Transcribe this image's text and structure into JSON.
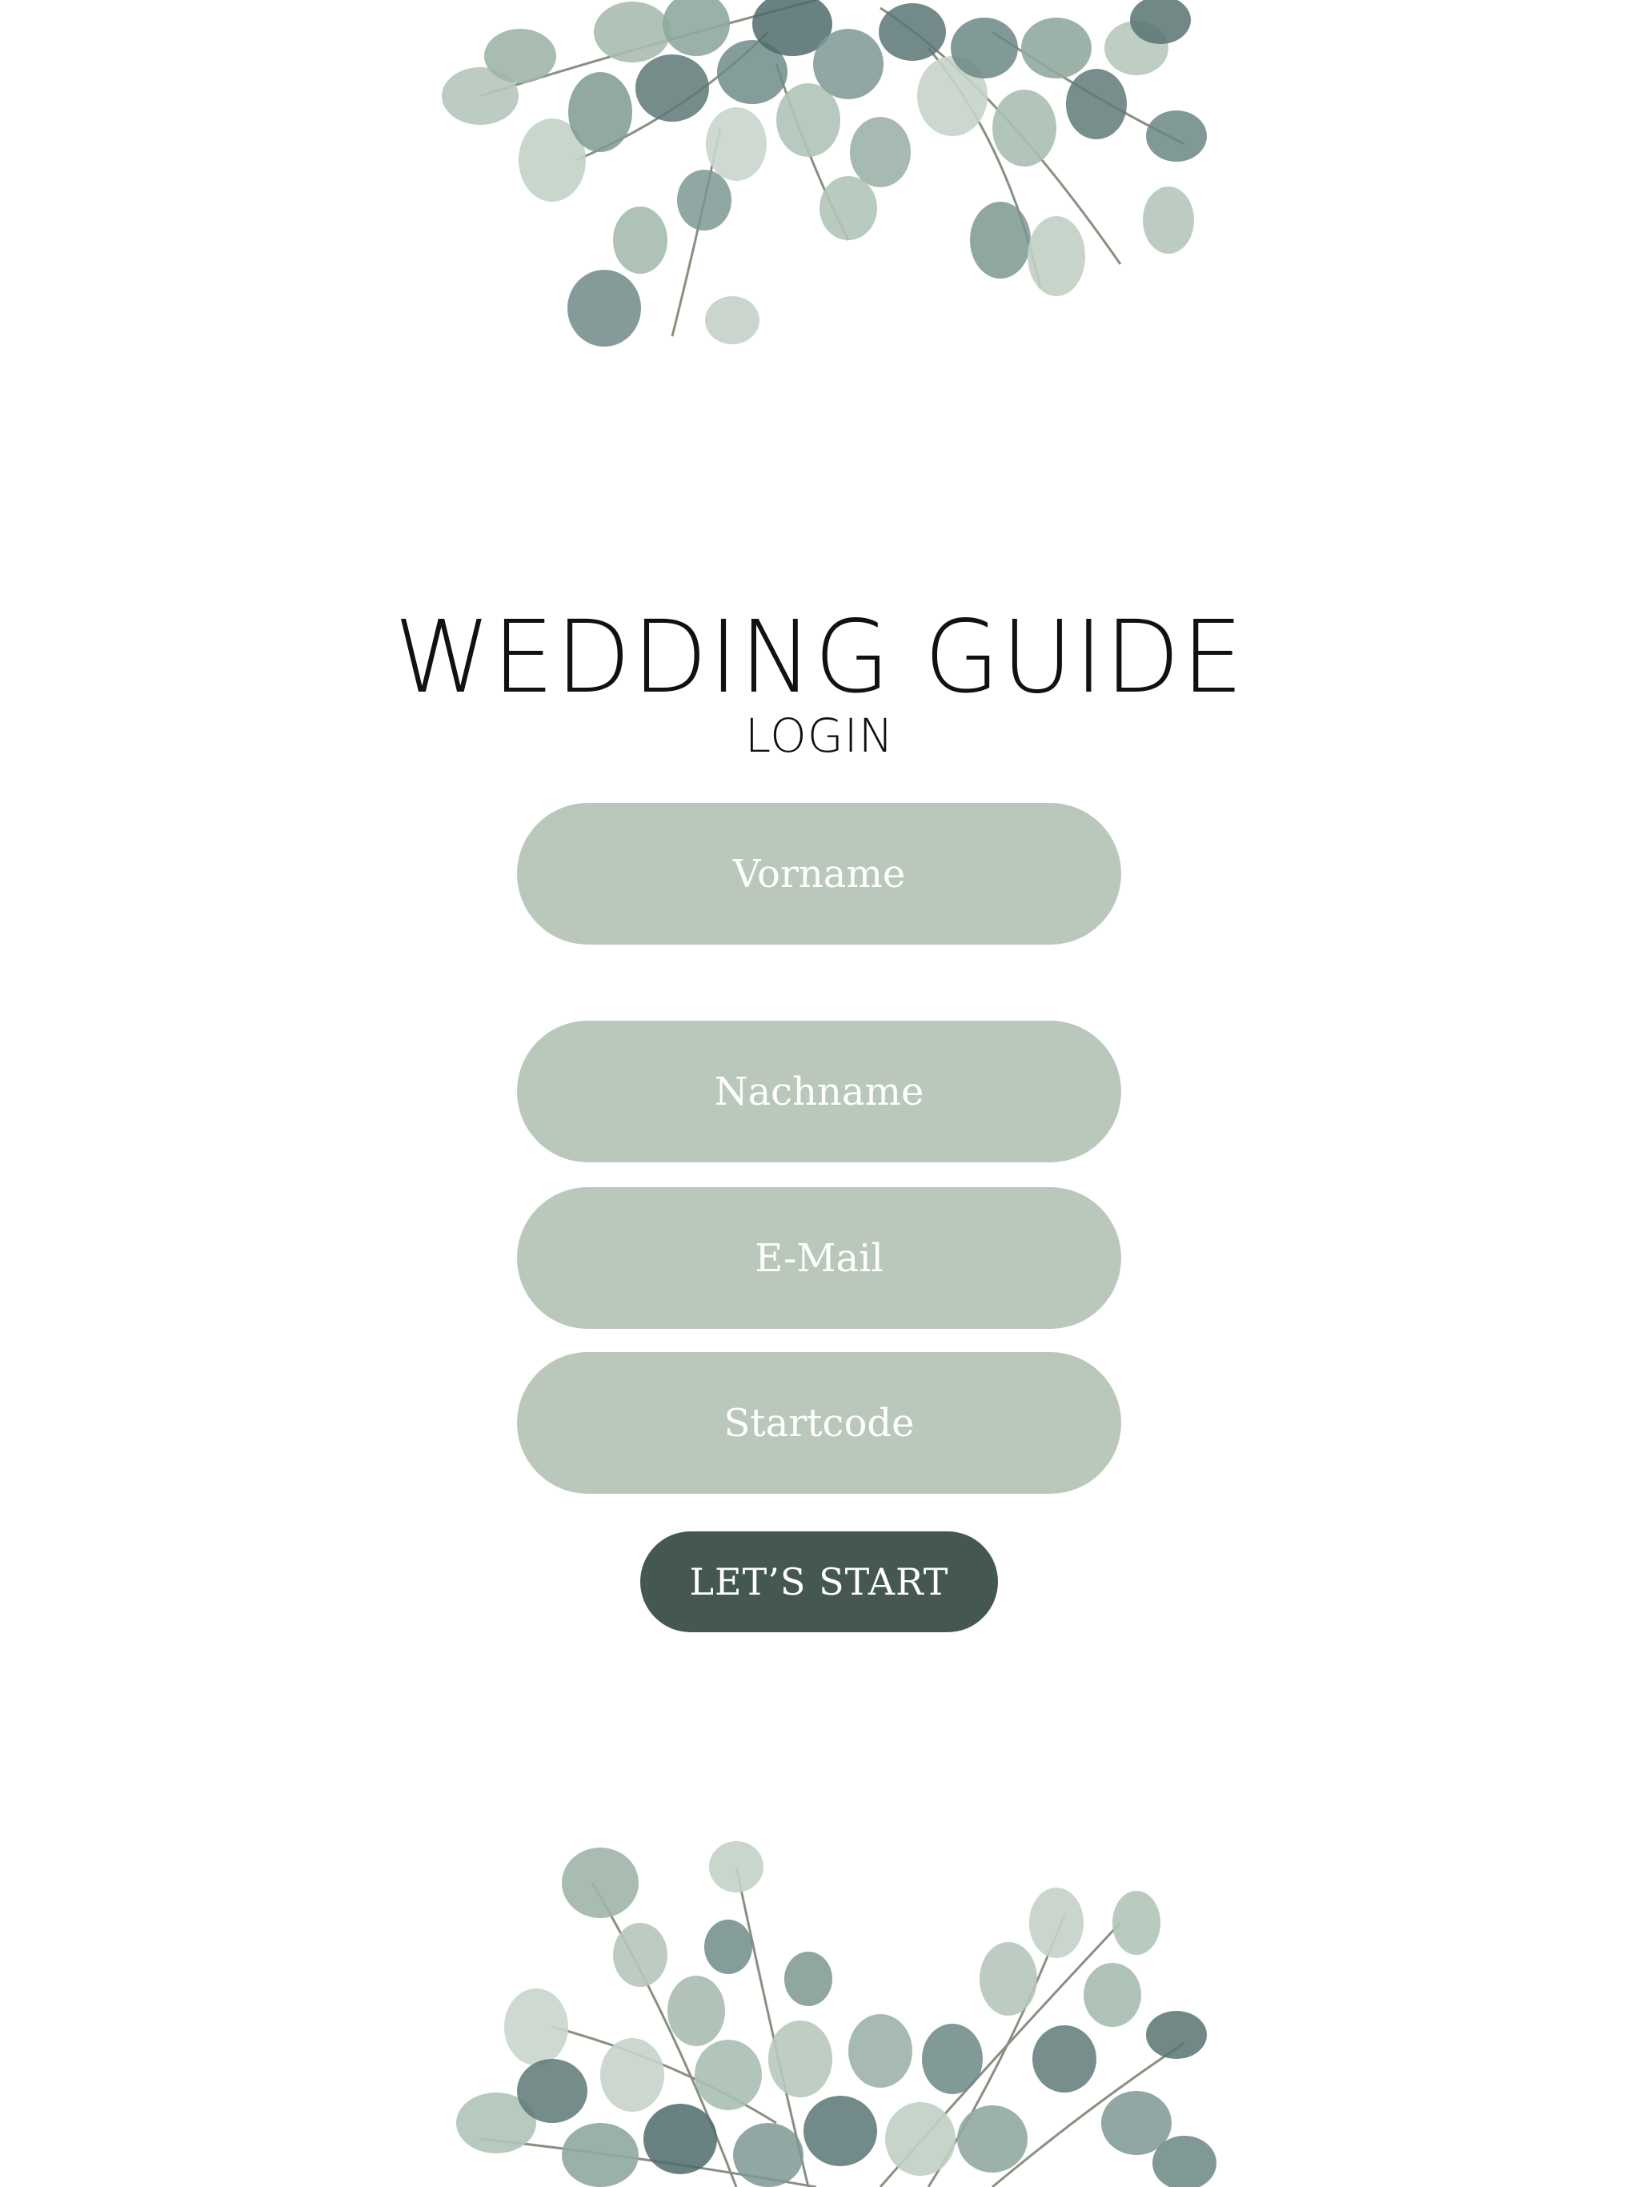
{
  "app": {
    "title": "WEDDING GUIDE",
    "subtitle": "LOGIN"
  },
  "form": {
    "first_name_placeholder": "Vorname",
    "last_name_placeholder": "Nachname",
    "email_placeholder": "E-Mail",
    "start_code_placeholder": "Startcode",
    "submit_label": "LET’S START"
  },
  "colors": {
    "background": "#ffffff",
    "field_fill": "#bac8bb",
    "button_fill": "#44584f",
    "title_text": "#111111",
    "leaf_light": "#a9bdb1",
    "leaf_dark": "#4f6b6b"
  },
  "decorations": [
    "eucalyptus-top",
    "eucalyptus-bottom"
  ]
}
